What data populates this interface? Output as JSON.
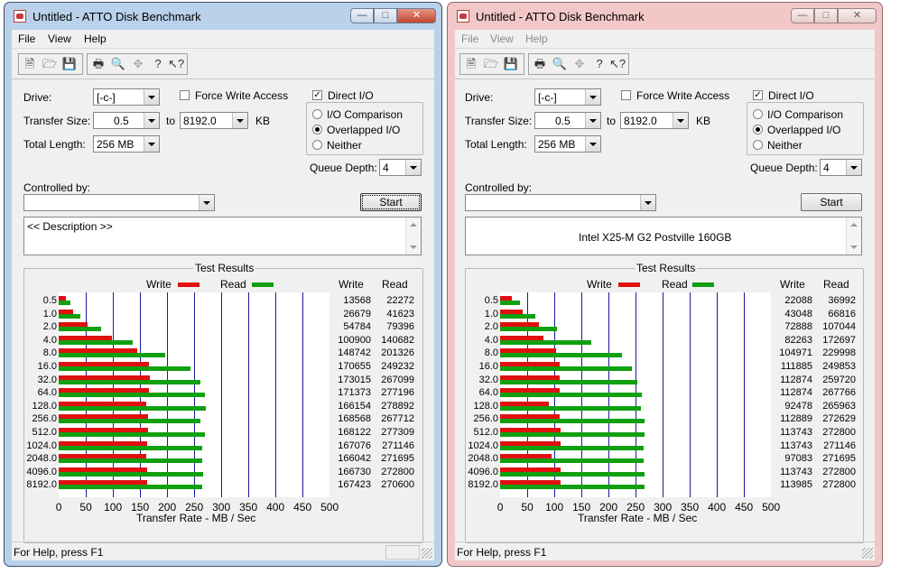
{
  "menus": [
    "File",
    "View",
    "Help"
  ],
  "toolbar_icons": [
    "new-icon",
    "open-icon",
    "save-icon",
    "print-icon",
    "print-preview-icon",
    "move-icon",
    "help-icon",
    "context-help-icon"
  ],
  "labels": {
    "drive": "Drive:",
    "transfer_size": "Transfer Size:",
    "to": "to",
    "kb": "KB",
    "total_length": "Total Length:",
    "force_write": "Force Write Access",
    "direct_io": "Direct I/O",
    "io_comparison": "I/O Comparison",
    "overlapped_io": "Overlapped I/O",
    "neither": "Neither",
    "queue_depth": "Queue Depth:",
    "controlled_by": "Controlled by:",
    "start": "Start",
    "test_results": "Test Results",
    "write": "Write",
    "read": "Read",
    "x_axis_title": "Transfer Rate - MB / Sec",
    "status": "For Help, press F1"
  },
  "colors": {
    "write": "#e01010",
    "read": "#10a010",
    "gridline": "#1a1aa0"
  },
  "windows": [
    {
      "title": "Untitled - ATTO Disk Benchmark",
      "active": true,
      "drive": "[-c-]",
      "transfer_from": "0.5",
      "transfer_to": "8192.0",
      "total_length": "256 MB",
      "queue_depth": "4",
      "force_write": false,
      "direct_io": true,
      "description": "<< Description >>",
      "chart_data": {
        "type": "bar",
        "title": "Test Results",
        "xlabel": "Transfer Rate - MB / Sec",
        "xlim": [
          0,
          500
        ],
        "xticks": [
          "0",
          "50",
          "100",
          "150",
          "200",
          "250",
          "300",
          "350",
          "400",
          "450",
          "500"
        ],
        "categories": [
          "0.5",
          "1.0",
          "2.0",
          "4.0",
          "8.0",
          "16.0",
          "32.0",
          "64.0",
          "128.0",
          "256.0",
          "512.0",
          "1024.0",
          "2048.0",
          "4096.0",
          "8192.0"
        ],
        "series": [
          {
            "name": "Write",
            "values": [
              "13568",
              "26679",
              "54784",
              "100900",
              "148742",
              "170655",
              "173015",
              "171373",
              "166154",
              "168568",
              "168122",
              "167076",
              "166042",
              "166730",
              "167423"
            ]
          },
          {
            "name": "Read",
            "values": [
              "22272",
              "41623",
              "79396",
              "140682",
              "201326",
              "249232",
              "267099",
              "277196",
              "278892",
              "267712",
              "277309",
              "271146",
              "271695",
              "272800",
              "270600"
            ]
          }
        ]
      }
    },
    {
      "title": "Untitled - ATTO Disk Benchmark",
      "active": false,
      "drive": "[-c-]",
      "transfer_from": "0.5",
      "transfer_to": "8192.0",
      "total_length": "256 MB",
      "queue_depth": "4",
      "force_write": false,
      "direct_io": true,
      "description": "Intel X25-M G2 Postville 160GB",
      "chart_data": {
        "type": "bar",
        "title": "Test Results",
        "xlabel": "Transfer Rate - MB / Sec",
        "xlim": [
          0,
          500
        ],
        "xticks": [
          "0",
          "50",
          "100",
          "150",
          "200",
          "250",
          "300",
          "350",
          "400",
          "450",
          "500"
        ],
        "categories": [
          "0.5",
          "1.0",
          "2.0",
          "4.0",
          "8.0",
          "16.0",
          "32.0",
          "64.0",
          "128.0",
          "256.0",
          "512.0",
          "1024.0",
          "2048.0",
          "4096.0",
          "8192.0"
        ],
        "series": [
          {
            "name": "Write",
            "values": [
              "22088",
              "43048",
              "72888",
              "82263",
              "104971",
              "111885",
              "112874",
              "112874",
              "92478",
              "112889",
              "113743",
              "113743",
              "97083",
              "113743",
              "113985"
            ]
          },
          {
            "name": "Read",
            "values": [
              "36992",
              "66816",
              "107044",
              "172697",
              "229998",
              "249853",
              "259720",
              "267766",
              "265963",
              "272629",
              "272800",
              "271146",
              "271695",
              "272800",
              "272800"
            ]
          }
        ]
      }
    }
  ]
}
